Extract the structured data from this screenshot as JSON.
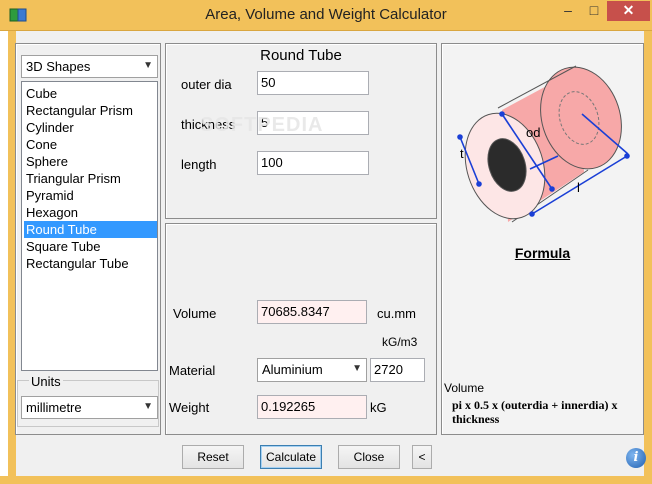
{
  "window": {
    "title": "Area, Volume and Weight Calculator",
    "minimize": "–",
    "maximize": "□",
    "close": "✕"
  },
  "shapes": {
    "category": "3D Shapes",
    "items": [
      "Cube",
      "Rectangular Prism",
      "Cylinder",
      "Cone",
      "Sphere",
      "Triangular Prism",
      "Pyramid",
      "Hexagon",
      "Round Tube",
      "Square Tube",
      "Rectangular Tube"
    ],
    "selected": "Round Tube"
  },
  "units": {
    "label": "Units",
    "value": "millimetre"
  },
  "inputs": {
    "title": "Round Tube",
    "outer_dia_label": "outer dia",
    "outer_dia_value": "50",
    "thickness_label": "thickness",
    "thickness_value": "5",
    "length_label": "length",
    "length_value": "100"
  },
  "results": {
    "volume_label": "Volume",
    "volume_value": "70685.8347",
    "volume_unit": "cu.mm",
    "density_unit": "kG/m3",
    "material_label": "Material",
    "material_value": "Aluminium",
    "density_value": "2720",
    "weight_label": "Weight",
    "weight_value": "0.192265",
    "weight_unit": "kG"
  },
  "diagram": {
    "label_t": "t",
    "label_od": "od",
    "label_l": "l",
    "watermark": "SOFTPEDIA"
  },
  "formula": {
    "heading": "Formula",
    "type": "Volume",
    "text": "pi x 0.5 x (outerdia + innerdia) x thickness"
  },
  "buttons": {
    "reset": "Reset",
    "calculate": "Calculate",
    "close": "Close",
    "back": "<",
    "info": "i"
  },
  "colors": {
    "titlebar": "#f2c15a",
    "tube_fill": "#f7a8a8",
    "dimension_lines": "#1a3fd6",
    "selection": "#3399ff"
  }
}
